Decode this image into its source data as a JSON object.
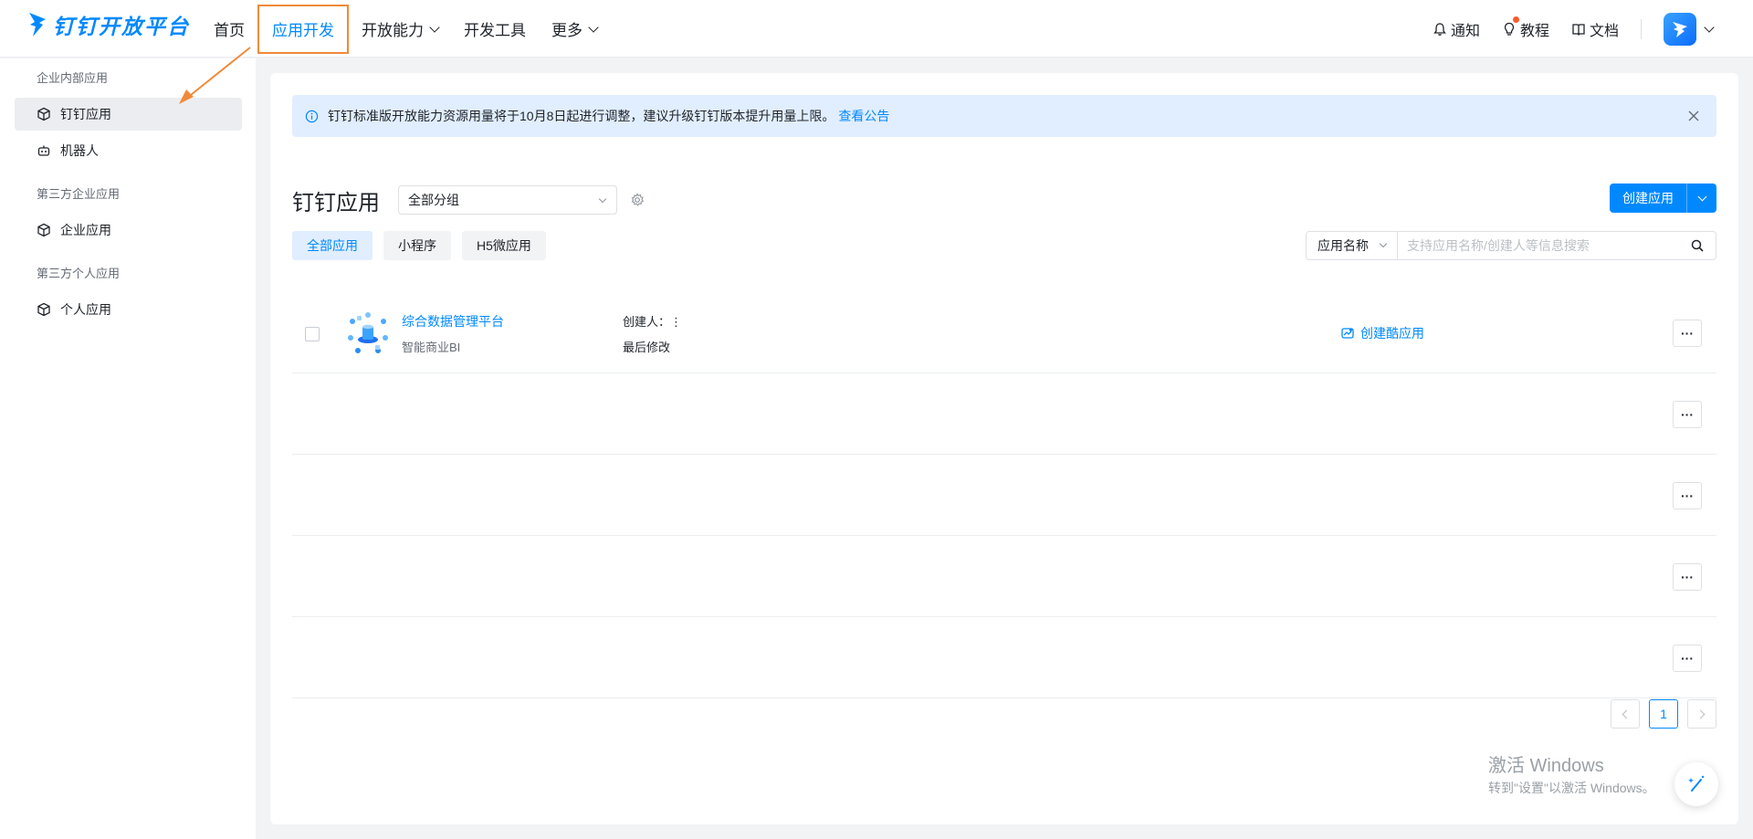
{
  "nav": {
    "logo_text": "钉钉开放平台",
    "items": [
      {
        "label": "首页"
      },
      {
        "label": "应用开发"
      },
      {
        "label": "开放能力"
      },
      {
        "label": "开发工具"
      },
      {
        "label": "更多"
      }
    ],
    "right": {
      "notify": "通知",
      "tutorial": "教程",
      "docs": "文档"
    }
  },
  "sidebar": {
    "groups": [
      {
        "title": "企业内部应用",
        "items": [
          {
            "label": "钉钉应用"
          },
          {
            "label": "机器人"
          }
        ]
      },
      {
        "title": "第三方企业应用",
        "items": [
          {
            "label": "企业应用"
          }
        ]
      },
      {
        "title": "第三方个人应用",
        "items": [
          {
            "label": "个人应用"
          }
        ]
      }
    ]
  },
  "notice": {
    "text": "钉钉标准版开放能力资源用量将于10月8日起进行调整，建议升级钉钉版本提升用量上限。",
    "link": "查看公告"
  },
  "main": {
    "title": "钉钉应用",
    "group_select": "全部分组",
    "create_button": "创建应用",
    "tabs": [
      {
        "label": "全部应用"
      },
      {
        "label": "小程序"
      },
      {
        "label": "H5微应用"
      }
    ],
    "search": {
      "type": "应用名称",
      "placeholder": "支持应用名称/创建人等信息搜索"
    }
  },
  "apps": [
    {
      "name": "综合数据管理平台",
      "subtitle": "智能商业BI",
      "creator_label": "创建人：",
      "modified_label": "最后修改",
      "action": "创建酷应用"
    }
  ],
  "more_label": "···",
  "pagination": {
    "current": "1"
  },
  "watermark": {
    "title": "激活 Windows",
    "subtitle": "转到\"设置\"以激活 Windows。"
  },
  "colors": {
    "brand": "#0089ff",
    "annotation": "#f08a3a"
  }
}
